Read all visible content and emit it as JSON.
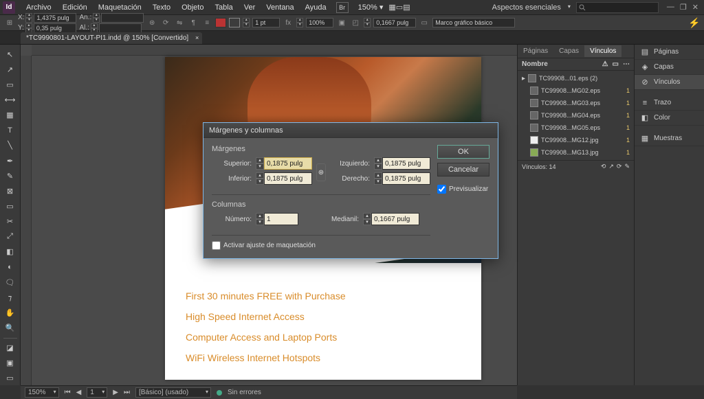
{
  "app": {
    "logo": "Id"
  },
  "menu": {
    "archivo": "Archivo",
    "edicion": "Edición",
    "maquetacion": "Maquetación",
    "texto": "Texto",
    "objeto": "Objeto",
    "tabla": "Tabla",
    "ver": "Ver",
    "ventana": "Ventana",
    "ayuda": "Ayuda"
  },
  "zoom": "150%",
  "workspace": "Aspectos esenciales",
  "coords": {
    "x": "1,4375 pulg",
    "y": "0,35 pulg",
    "w": "",
    "h": ""
  },
  "stroke_pt": "1 pt",
  "fill_pct": "100%",
  "measure": "0,1667 pulg",
  "style": "Marco gráfico básico",
  "tab_title": "*TC9990801-LAYOUT-PI1.indd @ 150% [Convertido]",
  "page_text": {
    "l1": "First 30 minutes FREE with Purchase",
    "l2": "High Speed Internet Access",
    "l3": "Computer Access and Laptop Ports",
    "l4": "WiFi Wireless Internet Hotspots"
  },
  "links_panel": {
    "tabs": {
      "paginas": "Páginas",
      "capas": "Capas",
      "vinculos": "Vínculos"
    },
    "header": "Nombre",
    "items": [
      {
        "fn": "TC99908...01.eps (2)",
        "pg": ""
      },
      {
        "fn": "TC99908...MG02.eps",
        "pg": "1"
      },
      {
        "fn": "TC99908...MG03.eps",
        "pg": "1"
      },
      {
        "fn": "TC99908...MG04.eps",
        "pg": "1"
      },
      {
        "fn": "TC99908...MG05.eps",
        "pg": "1"
      },
      {
        "fn": "TC99908...MG12.jpg",
        "pg": "1"
      },
      {
        "fn": "TC99908...MG13.jpg",
        "pg": "1"
      }
    ],
    "footer": "Vínculos: 14"
  },
  "rightcol": {
    "paginas": "Páginas",
    "capas": "Capas",
    "vinculos": "Vínculos",
    "trazo": "Trazo",
    "color": "Color",
    "muestras": "Muestras"
  },
  "status": {
    "zoom": "150%",
    "page": "1",
    "style": "[Básico] (usado)",
    "errors": "Sin errores"
  },
  "dialog": {
    "title": "Márgenes y columnas",
    "margenes": "Márgenes",
    "superior_lbl": "Superior:",
    "superior": "0,1875 pulg",
    "inferior_lbl": "Inferior:",
    "inferior": "0,1875 pulg",
    "izquierdo_lbl": "Izquierdo:",
    "izquierdo": "0,1875 pulg",
    "derecho_lbl": "Derecho:",
    "derecho": "0,1875 pulg",
    "columnas": "Columnas",
    "numero_lbl": "Número:",
    "numero": "1",
    "medianil_lbl": "Medianil:",
    "medianil": "0,1667 pulg",
    "activar": "Activar ajuste de maquetación",
    "ok": "OK",
    "cancelar": "Cancelar",
    "previsualizar": "Previsualizar"
  }
}
